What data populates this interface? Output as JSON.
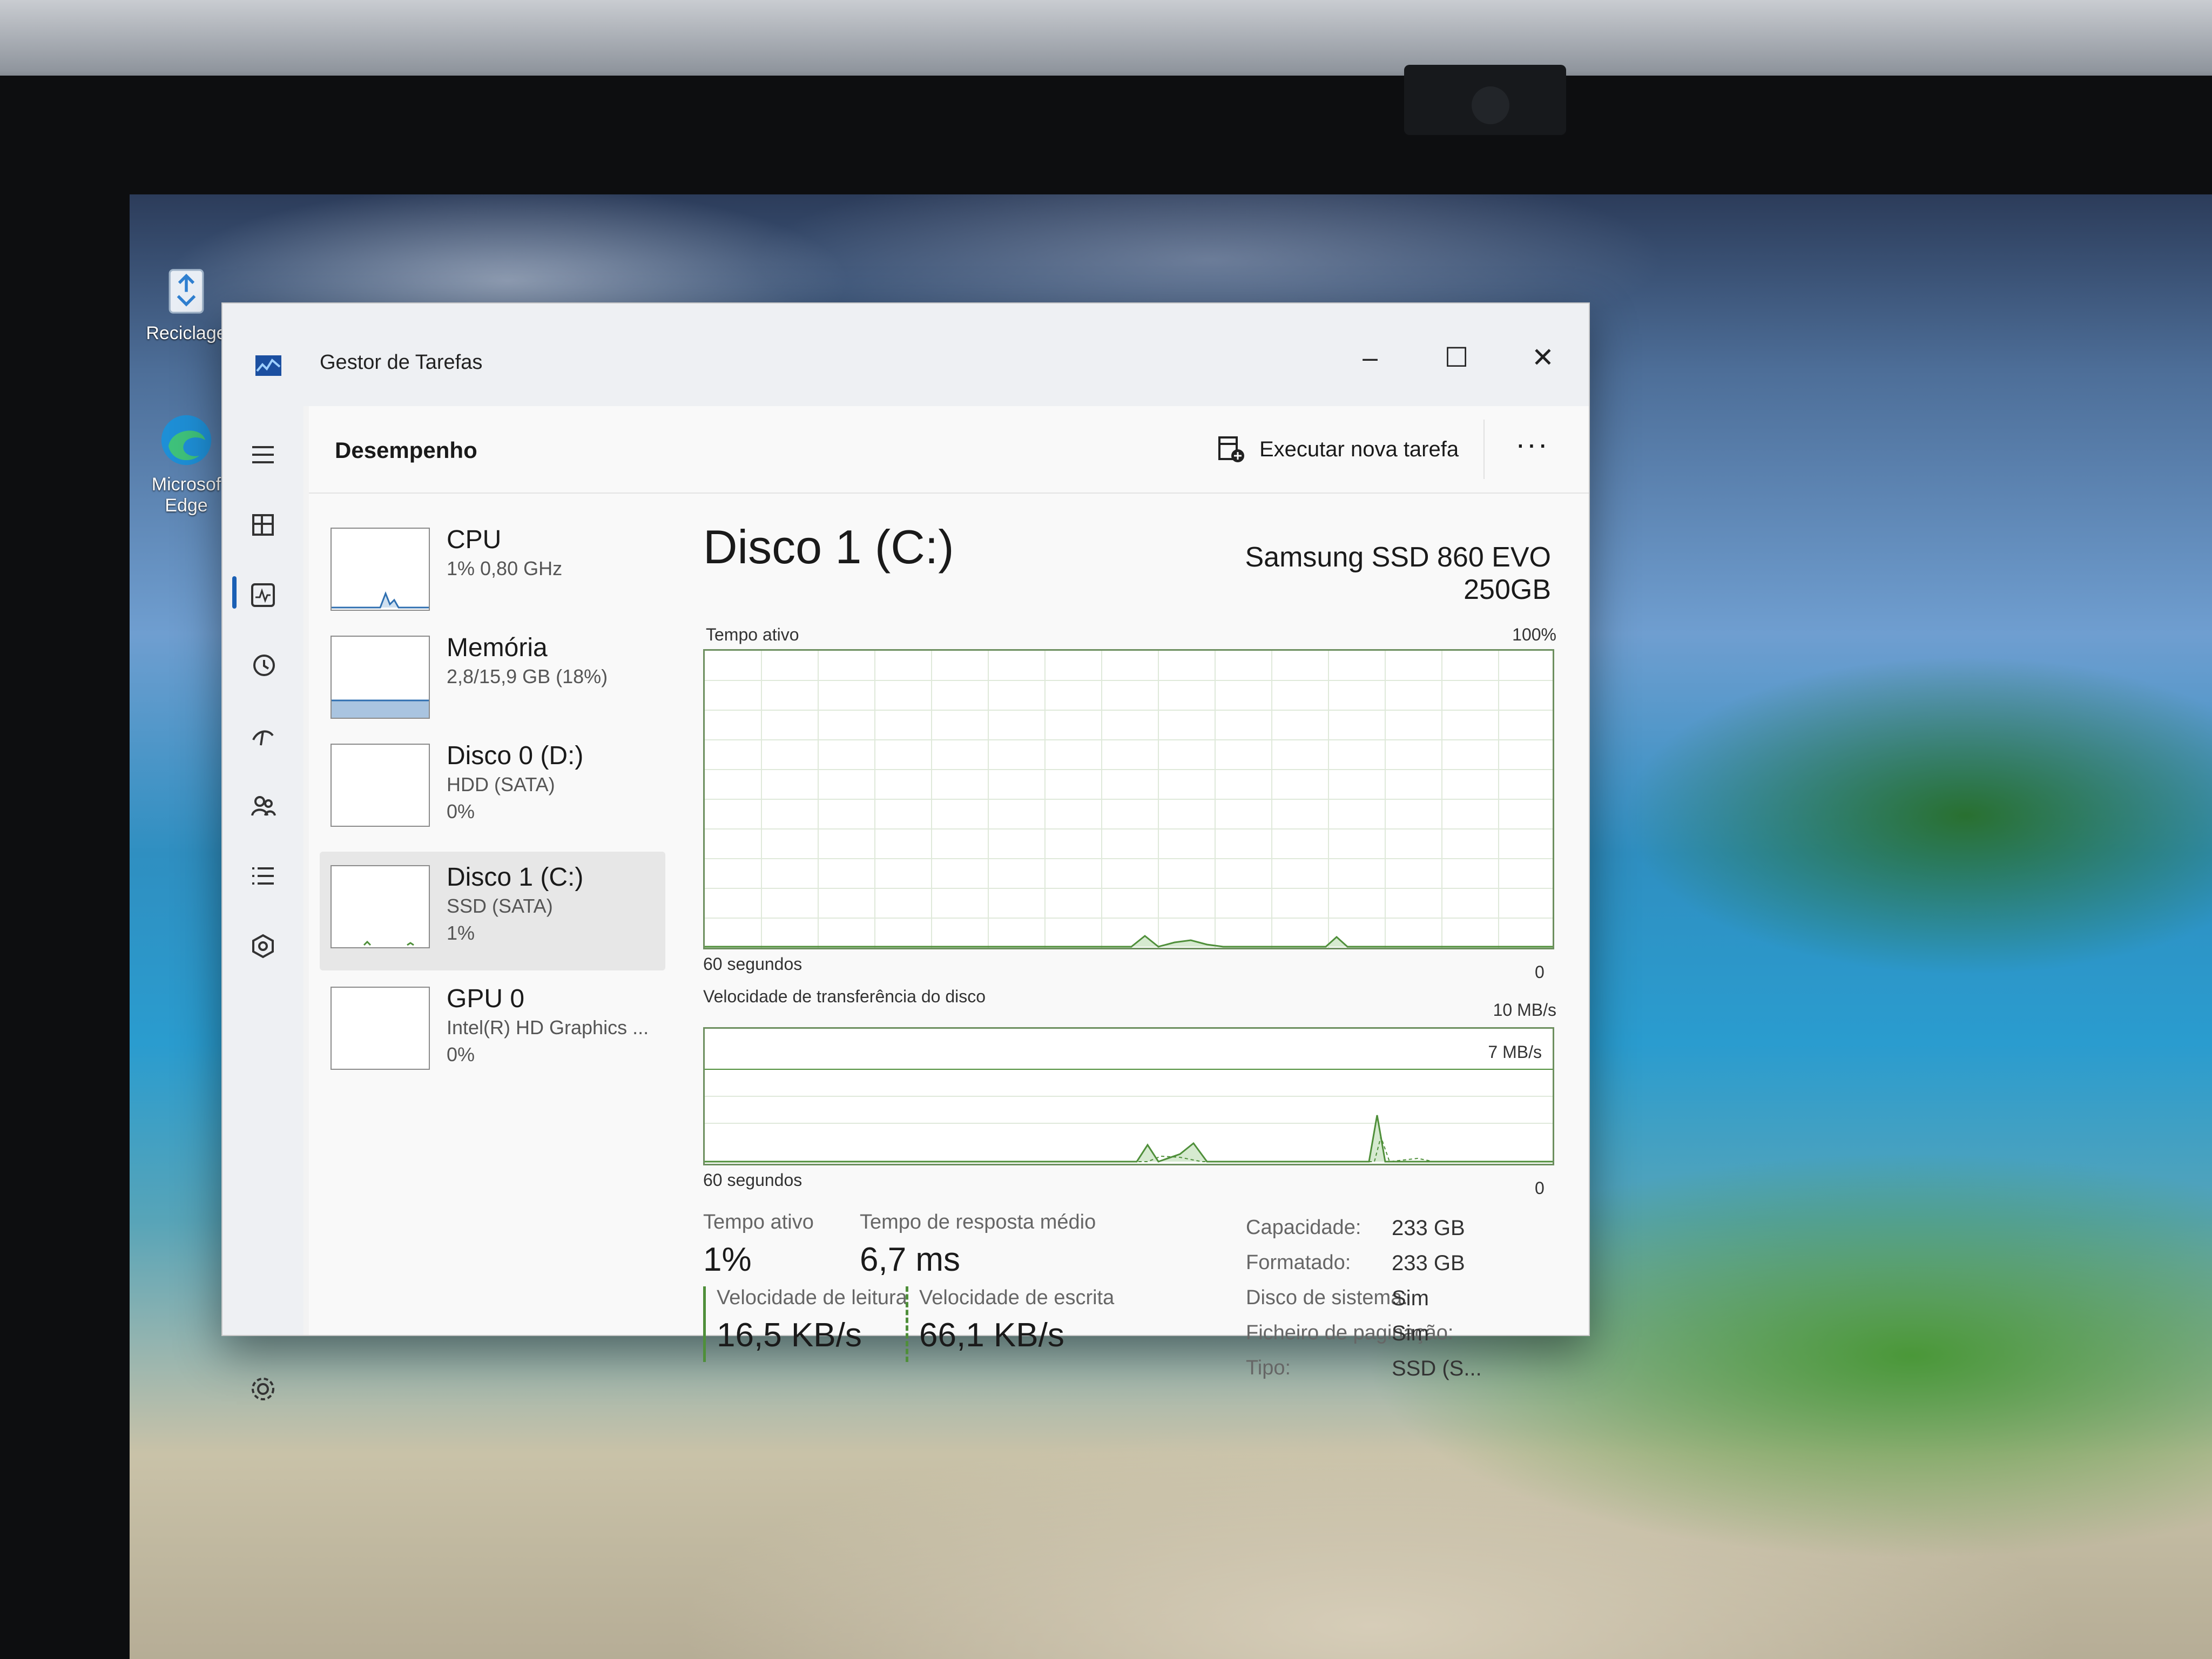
{
  "desktop": {
    "recycle_bin_label": "Reciclage",
    "edge_label_1": "Microsof",
    "edge_label_2": "Edge"
  },
  "window": {
    "title": "Gestor de Tarefas",
    "minimize": "–",
    "maximize": "☐",
    "close": "✕"
  },
  "header": {
    "title": "Desempenho",
    "run_new_task": "Executar nova tarefa",
    "more": "···"
  },
  "devices": [
    {
      "name": "CPU",
      "sub1": "1% 0,80 GHz",
      "sub2": ""
    },
    {
      "name": "Memória",
      "sub1": "2,8/15,9 GB (18%)",
      "sub2": ""
    },
    {
      "name": "Disco 0 (D:)",
      "sub1": "HDD (SATA)",
      "sub2": "0%"
    },
    {
      "name": "Disco 1 (C:)",
      "sub1": "SSD (SATA)",
      "sub2": "1%"
    },
    {
      "name": "GPU 0",
      "sub1": "Intel(R) HD Graphics ...",
      "sub2": "0%"
    }
  ],
  "selected_device": "Disco 1 (C:)",
  "detail": {
    "title": "Disco 1 (C:)",
    "model": "Samsung SSD 860 EVO 250GB",
    "graph1": {
      "label": "Tempo ativo",
      "max": "100%",
      "time": "60 segundos",
      "min": "0"
    },
    "graph2": {
      "label": "Velocidade de transferência do disco",
      "max": "10 MB/s",
      "inner": "7 MB/s",
      "time": "60 segundos",
      "min": "0"
    },
    "stats": {
      "active_time_label": "Tempo ativo",
      "active_time_value": "1%",
      "response_label": "Tempo de resposta médio",
      "response_value": "6,7 ms",
      "read_label": "Velocidade de leitura",
      "read_value": "16,5 KB/s",
      "write_label": "Velocidade de escrita",
      "write_value": "66,1 KB/s"
    },
    "properties": [
      {
        "label": "Capacidade:",
        "value": "233 GB"
      },
      {
        "label": "Formatado:",
        "value": "233 GB"
      },
      {
        "label": "Disco de sistema:",
        "value": "Sim"
      },
      {
        "label": "Ficheiro de paginação:",
        "value": "Sim"
      },
      {
        "label": "Tipo:",
        "value": "SSD (S..."
      }
    ]
  },
  "colors": {
    "accent": "#1a5fb4",
    "graph_line": "#4f8f3a",
    "graph_border": "#6d8f5f"
  }
}
